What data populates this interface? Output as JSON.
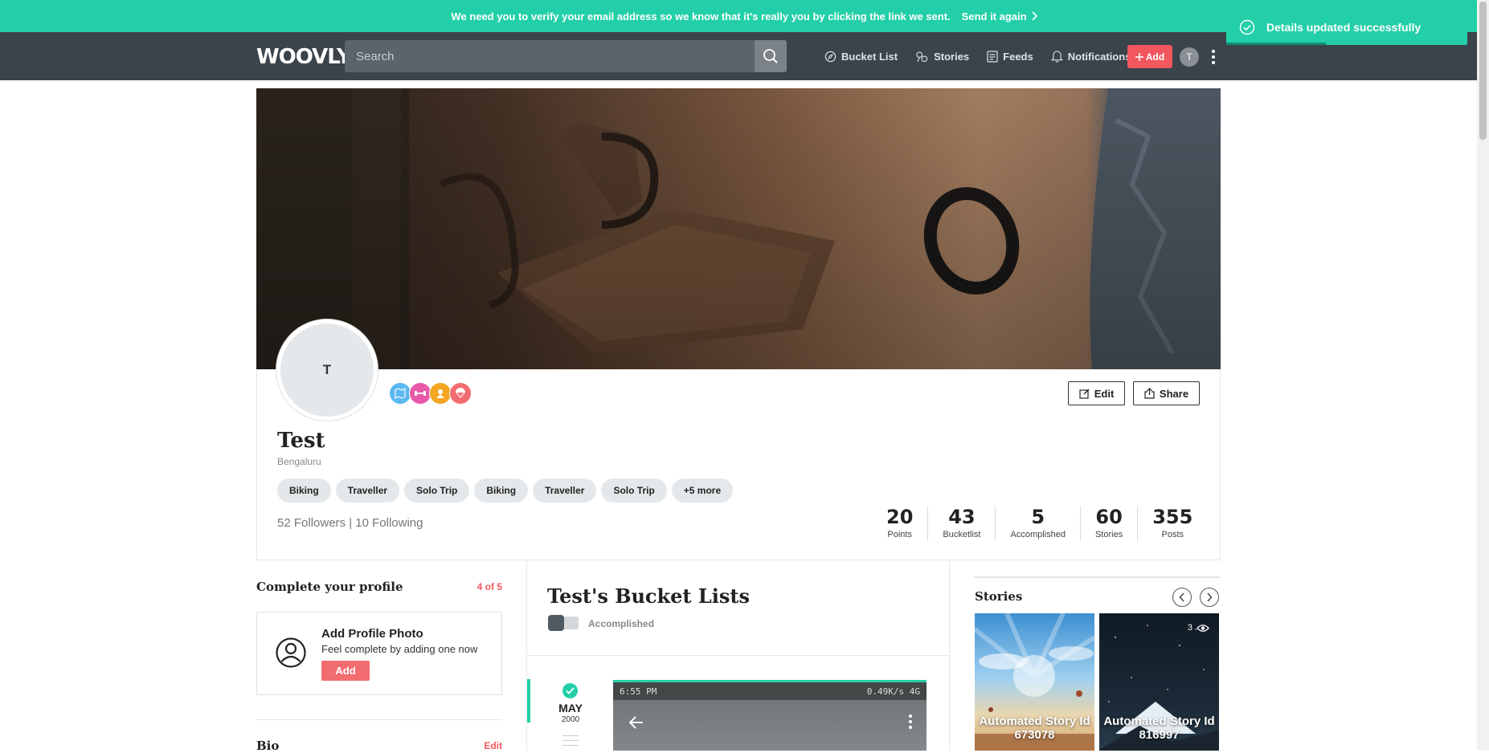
{
  "verify_banner": {
    "message": "We need you to verify your email address so we know that it's really you by clicking the link we sent.",
    "action": "Send it again"
  },
  "toast": {
    "message": "Details updated successfully"
  },
  "nav": {
    "logo": "WOOVLY",
    "search_placeholder": "Search",
    "items": [
      {
        "label": "Bucket List",
        "icon": "compass-icon"
      },
      {
        "label": "Stories",
        "icon": "stories-icon"
      },
      {
        "label": "Feeds",
        "icon": "feeds-icon"
      },
      {
        "label": "Notifications",
        "icon": "bell-icon"
      }
    ],
    "add_label": "Add",
    "avatar_initial": "T"
  },
  "profile": {
    "avatar_initial": "T",
    "name": "Test",
    "location": "Bengaluru",
    "edit_label": "Edit",
    "share_label": "Share",
    "tags": [
      "Biking",
      "Traveller",
      "Solo Trip",
      "Biking",
      "Traveller",
      "Solo Trip",
      "+5 more"
    ],
    "followers_text": "52 Followers | 10 Following",
    "stats": [
      {
        "value": "20",
        "label": "Points"
      },
      {
        "value": "43",
        "label": "Bucketlist"
      },
      {
        "value": "5",
        "label": "Accomplished"
      },
      {
        "value": "60",
        "label": "Stories"
      },
      {
        "value": "355",
        "label": "Posts"
      }
    ],
    "badge_colors": [
      "#5bb8f0",
      "#e85aa8",
      "#f5a623",
      "#f26d70"
    ]
  },
  "complete_profile": {
    "title": "Complete your profile",
    "progress": "4 of 5",
    "card_title": "Add Profile Photo",
    "card_subtitle": "Feel complete by adding one now",
    "card_button": "Add"
  },
  "bio": {
    "title": "Bio",
    "edit_label": "Edit"
  },
  "bucket_lists": {
    "title": "Test's Bucket Lists",
    "toggle_label": "Accomplished",
    "entry": {
      "month": "MAY",
      "year": "2000",
      "status_time": "6:55 PM",
      "status_right": "0.49K/s  4G"
    }
  },
  "stories": {
    "title": "Stories",
    "items": [
      {
        "label": "Automated Story Id 673078"
      },
      {
        "label": "Automated Story Id 816997",
        "views": "3"
      }
    ]
  },
  "colors": {
    "accent": "#23cfa8",
    "brand_red": "#f2575d",
    "nav_bg": "#3b434b"
  }
}
